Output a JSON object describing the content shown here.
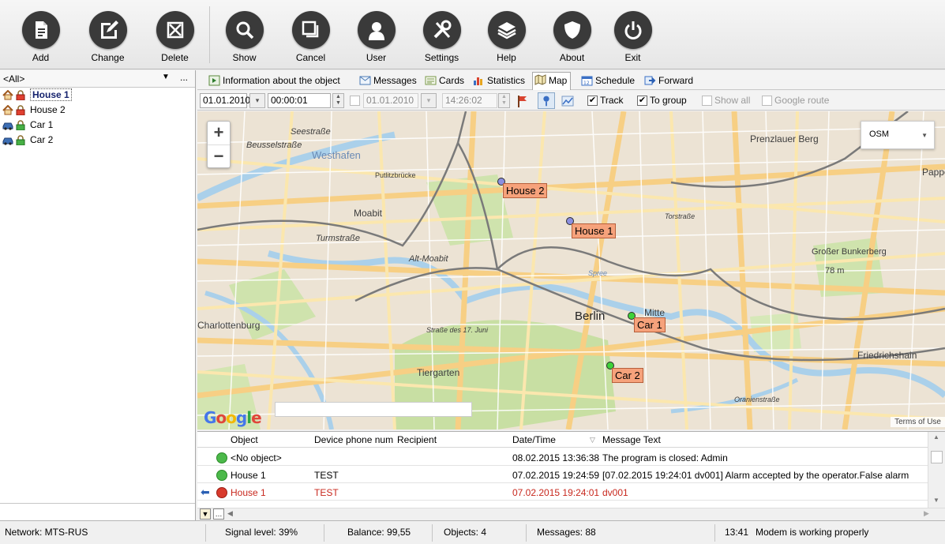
{
  "toolbar": {
    "buttons": [
      {
        "label": "Add",
        "icon": "add-document-icon"
      },
      {
        "label": "Change",
        "icon": "edit-icon"
      },
      {
        "label": "Delete",
        "icon": "delete-icon"
      },
      {
        "label": "Show",
        "icon": "magnifier-icon"
      },
      {
        "label": "Cancel",
        "icon": "cancel-windows-icon"
      },
      {
        "label": "User",
        "icon": "user-icon"
      },
      {
        "label": "Settings",
        "icon": "tools-icon"
      },
      {
        "label": "Help",
        "icon": "layers-icon"
      },
      {
        "label": "About",
        "icon": "shield-icon"
      },
      {
        "label": "Exit",
        "icon": "power-icon"
      }
    ]
  },
  "left_panel": {
    "filter": "<All>",
    "more": "...",
    "items": [
      {
        "label": "House 1",
        "type": "house",
        "selected": true
      },
      {
        "label": "House 2",
        "type": "house",
        "selected": false
      },
      {
        "label": "Car 1",
        "type": "car",
        "selected": false
      },
      {
        "label": "Car 2",
        "type": "car",
        "selected": false
      }
    ]
  },
  "tabs": [
    {
      "label": "Information about the object",
      "icon": "info-icon"
    },
    {
      "label": "Messages",
      "icon": "envelope-icon"
    },
    {
      "label": "Cards",
      "icon": "cards-icon"
    },
    {
      "label": "Statistics",
      "icon": "bar-chart-icon"
    },
    {
      "label": "Map",
      "icon": "map-icon",
      "active": true
    },
    {
      "label": "Schedule",
      "icon": "calendar-icon"
    },
    {
      "label": "Forward",
      "icon": "forward-arrow-icon"
    }
  ],
  "filter_bar": {
    "date_from": "01.01.2010",
    "time_from": "00:00:01",
    "date_to": "01.01.2010",
    "time_to": "14:26:02",
    "track_label": "Track",
    "to_group_label": "To group",
    "show_all_label": "Show all",
    "google_route_label": "Google route"
  },
  "map": {
    "layer": "OSM",
    "zoom_in": "+",
    "zoom_out": "−",
    "labels": [
      "Seestraße",
      "Beusselstraße",
      "Westhafen",
      "Putlitzbrücke",
      "Moabit",
      "Turmstraße",
      "Alt-Moabit",
      "Prenzlauer Berg",
      "Großer Bunkerberg",
      "78 m",
      "Mitte",
      "Berlin",
      "Friedrichshain",
      "Charlottenburg",
      "Straße des 17. Juni",
      "Tiergarten",
      "Oranienstraße",
      "Torstraße",
      "Spree",
      "Pappe"
    ],
    "markers": [
      {
        "label": "House 2",
        "kind": "house"
      },
      {
        "label": "House 1",
        "kind": "house"
      },
      {
        "label": "Car 1",
        "kind": "car"
      },
      {
        "label": "Car 2",
        "kind": "car"
      }
    ],
    "google_logo": "Google",
    "terms": "Terms of Use"
  },
  "grid": {
    "columns": [
      "Object",
      "Device phone num",
      "Recipient",
      "Date/Time",
      "Message Text"
    ],
    "rows": [
      {
        "status": "ok",
        "object": "<No object>",
        "phone": "",
        "recipient": "",
        "datetime": "08.02.2015 13:36:38",
        "text": "The program is closed: Admin",
        "alarm": false
      },
      {
        "status": "ok",
        "object": "House 1",
        "phone": "TEST",
        "recipient": "",
        "datetime": "07.02.2015 19:24:59",
        "text": "[07.02.2015 19:24:01 dv001] Alarm accepted by the operator.False alarm",
        "alarm": false
      },
      {
        "status": "error",
        "object": "House 1",
        "phone": "TEST",
        "recipient": "",
        "datetime": "07.02.2015 19:24:01",
        "text": "dv001",
        "alarm": true
      }
    ]
  },
  "status_bar": {
    "network": "Network: MTS-RUS",
    "signal": "Signal level: 39%",
    "balance": "Balance: 99,55",
    "objects": "Objects: 4",
    "messages": "Messages: 88",
    "time": "13:41",
    "modem": "Modem is working properly"
  }
}
